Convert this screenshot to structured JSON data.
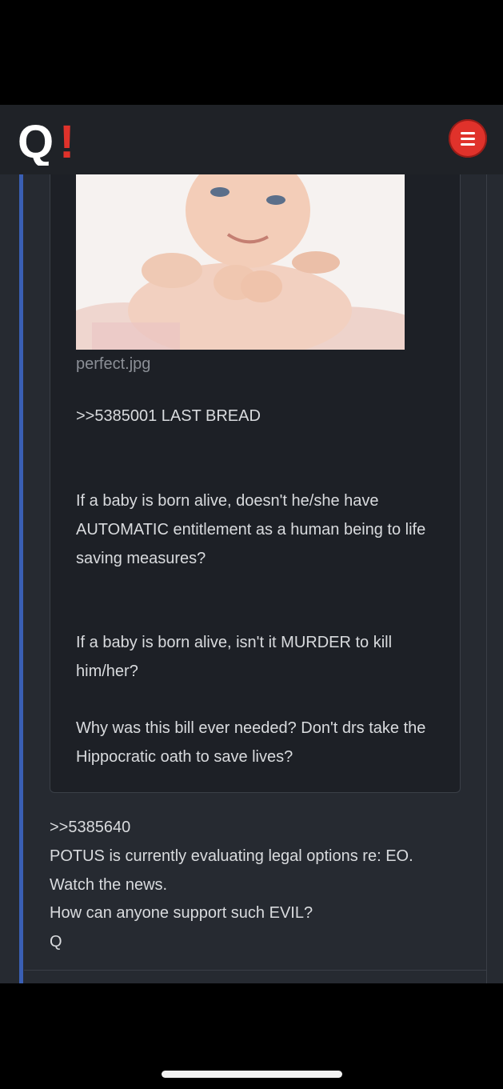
{
  "header": {
    "logo_letter": "Q",
    "logo_mark": "!",
    "menu_icon": "hamburger-menu-icon",
    "brand_color": "#e0322b"
  },
  "quoted_post": {
    "image_alt": "smiling baby photo",
    "filename": "perfect.jpg",
    "reference": ">>5385001 LAST  BREAD",
    "paragraphs": [
      "If a baby is born alive, doesn't he/she have AUTOMATIC entitlement as a human being to life saving measures?",
      "If a baby is born alive, isn't it MURDER to kill him/her?",
      "Why was this bill ever needed? Don't drs take the Hippocratic oath to save lives?"
    ]
  },
  "post": {
    "reference": ">>5385640",
    "lines": [
      "POTUS is currently evaluating legal options re: EO.",
      "Watch the news.",
      "How can anyone support such EVIL?",
      "Q"
    ]
  }
}
